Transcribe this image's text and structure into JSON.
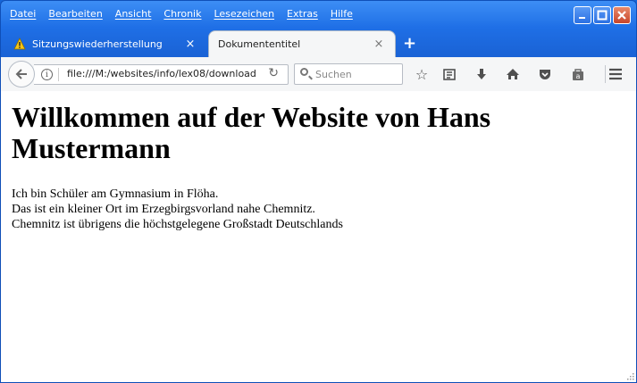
{
  "menu": [
    "Datei",
    "Bearbeiten",
    "Ansicht",
    "Chronik",
    "Lesezeichen",
    "Extras",
    "Hilfe"
  ],
  "tabs": [
    {
      "label": "Sitzungswiederherstellung",
      "icon": "warning-icon",
      "active": false
    },
    {
      "label": "Dokumententitel",
      "active": true
    }
  ],
  "tab_close": "×",
  "new_tab": "+",
  "url": "file:///M:/websites/info/lex08/download",
  "search_placeholder": "Suchen",
  "toolbar_icons": [
    "star-icon",
    "reader-icon",
    "download-icon",
    "home-icon",
    "pocket-icon",
    "library-icon",
    "menu-icon"
  ],
  "page": {
    "heading": "Willkommen auf der Website von Hans Mustermann",
    "lines": [
      "Ich bin Schüler am Gymnasium in Flöha.",
      "Das ist ein kleiner Ort im Erzegbirgsvorland nahe Chemnitz.",
      "Chemnitz ist übrigens die höchstgelegene Großstadt Deutschlands"
    ]
  },
  "colors": {
    "titlebar": "#1f6fe6",
    "close": "#c8452a",
    "toolbar": "#f5f6f7"
  }
}
